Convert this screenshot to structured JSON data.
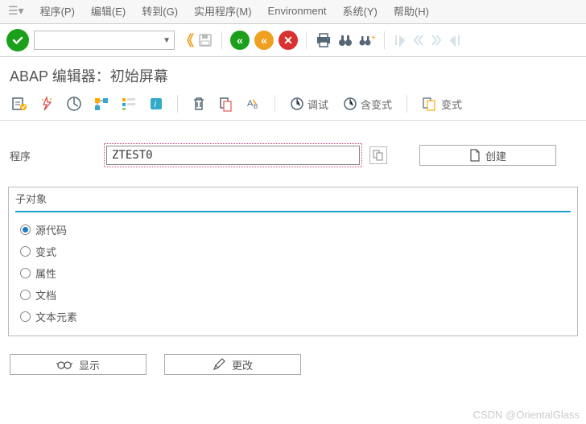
{
  "menubar": [
    "程序(P)",
    "编辑(E)",
    "转到(G)",
    "实用程序(M)",
    "Environment",
    "系统(Y)",
    "帮助(H)"
  ],
  "title": "ABAP 编辑器：初始屏幕",
  "app_toolbar": {
    "debug": "调试",
    "with_variant": "含变式",
    "variant": "变式"
  },
  "form": {
    "program_label": "程序",
    "program_value": "ZTEST0",
    "create": "创建"
  },
  "subobjects": {
    "title": "子对象",
    "options": [
      "源代码",
      "变式",
      "属性",
      "文档",
      "文本元素"
    ],
    "selected": 0
  },
  "actions": {
    "display": "显示",
    "change": "更改"
  },
  "watermark": "CSDN @OrientalGlass"
}
